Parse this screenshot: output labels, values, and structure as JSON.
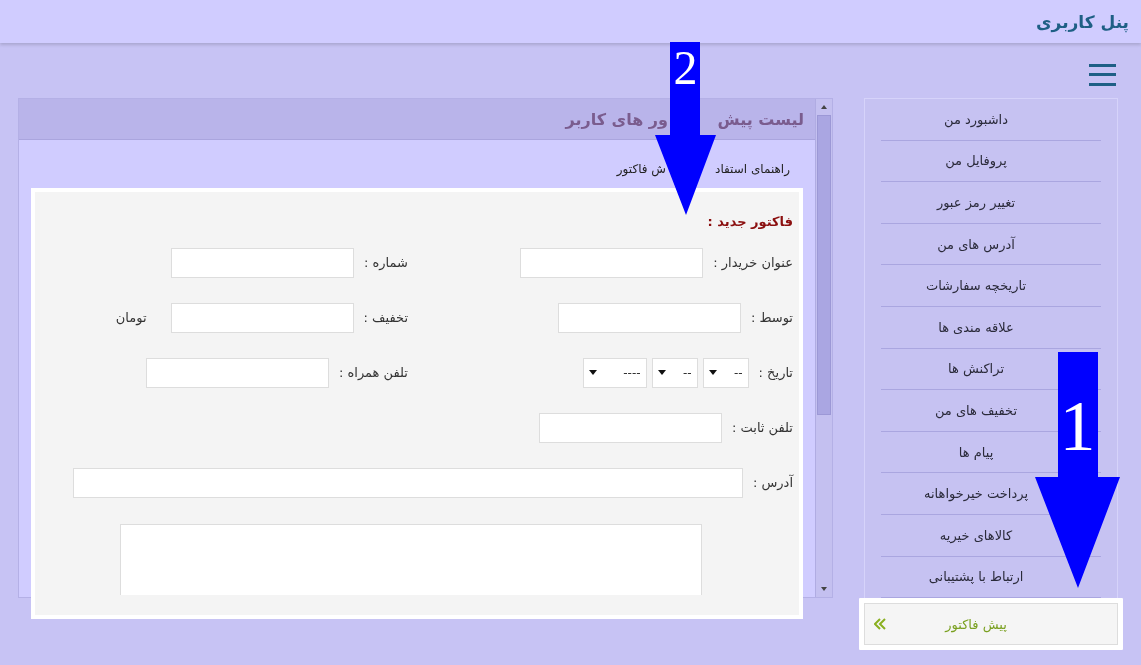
{
  "header": {
    "title": "پنل کاربری"
  },
  "sidebar": {
    "items": [
      {
        "label": "داشبورد من",
        "selected": false
      },
      {
        "label": "پروفایل من",
        "selected": false
      },
      {
        "label": "تغییر رمز عبور",
        "selected": false
      },
      {
        "label": "آدرس های من",
        "selected": false
      },
      {
        "label": "تاریخچه سفارشات",
        "selected": false
      },
      {
        "label": "علاقه مندی ها",
        "selected": false
      },
      {
        "label": "تراکنش ها",
        "selected": false
      },
      {
        "label": "تخفیف های من",
        "selected": false
      },
      {
        "label": "پیام ها",
        "selected": false
      },
      {
        "label": "پرداخت خیرخواهانه",
        "selected": false
      },
      {
        "label": "کالاهای خیریه",
        "selected": false
      },
      {
        "label": "ارتباط با پشتیبانی",
        "selected": false
      },
      {
        "label": "پیش فاکتور",
        "selected": true
      }
    ]
  },
  "panel": {
    "title_parts": [
      "لیست پیش",
      "ور های کاربر"
    ],
    "help_link_parts": [
      "راهنمای استفاد",
      "ش فاکتور"
    ],
    "form": {
      "heading": "فاکتور جدید :",
      "rows": [
        {
          "cells": [
            {
              "kind": "text",
              "label": "عنوان خریدار :"
            },
            {
              "kind": "text",
              "label": "شماره :"
            }
          ]
        },
        {
          "cells": [
            {
              "kind": "text",
              "label": "توسط :"
            },
            {
              "kind": "text",
              "label": "تخفیف :",
              "suffix": "تومان"
            }
          ]
        },
        {
          "cells": [
            {
              "kind": "date",
              "label": "تاریخ :",
              "selects": [
                "--",
                "--",
                "----"
              ]
            },
            {
              "kind": "text",
              "label": "تلفن همراه :"
            }
          ]
        },
        {
          "cells": [
            {
              "kind": "text",
              "label": "تلفن ثابت :"
            }
          ]
        },
        {
          "cells": [
            {
              "kind": "wide",
              "label": "آدرس :"
            }
          ]
        },
        {
          "cells": [
            {
              "kind": "textarea"
            }
          ]
        }
      ]
    }
  },
  "annotations": [
    {
      "label": "2"
    },
    {
      "label": "1"
    }
  ]
}
